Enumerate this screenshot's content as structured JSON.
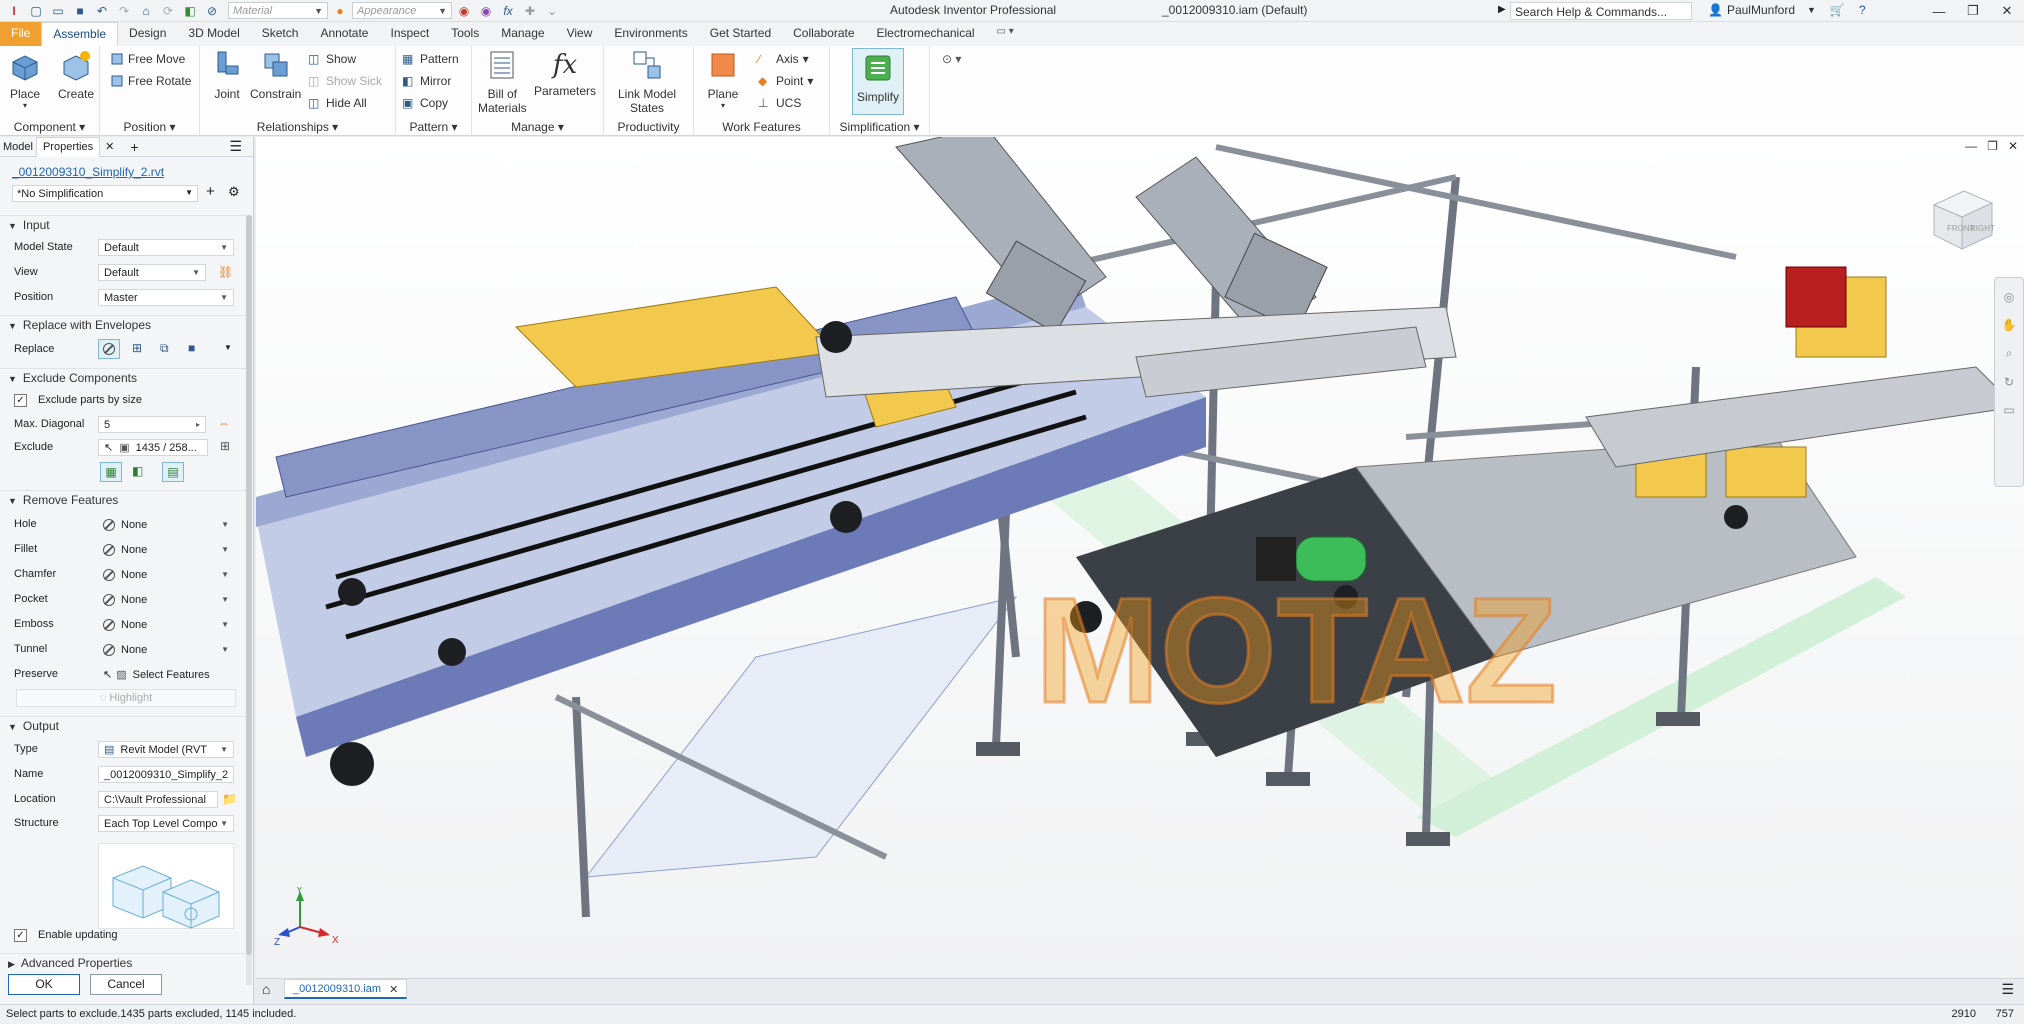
{
  "app": {
    "title": "Autodesk Inventor Professional",
    "document": "_0012009310.iam (Default)",
    "search_placeholder": "Search Help & Commands...",
    "user": "PaulMunford",
    "material_placeholder": "Material",
    "appearance_placeholder": "Appearance"
  },
  "tabs": [
    "File",
    "Assemble",
    "Design",
    "3D Model",
    "Sketch",
    "Annotate",
    "Inspect",
    "Tools",
    "Manage",
    "View",
    "Environments",
    "Get Started",
    "Collaborate",
    "Electromechanical"
  ],
  "active_tab": "Assemble",
  "ribbon": {
    "component": {
      "label": "Component",
      "place": "Place",
      "create": "Create"
    },
    "position": {
      "label": "Position",
      "free_move": "Free Move",
      "free_rotate": "Free Rotate"
    },
    "relationships": {
      "label": "Relationships",
      "joint": "Joint",
      "constrain": "Constrain",
      "show": "Show",
      "show_sick": "Show Sick",
      "hide_all": "Hide All"
    },
    "pattern": {
      "label": "Pattern",
      "pattern": "Pattern",
      "mirror": "Mirror",
      "copy": "Copy"
    },
    "manage": {
      "label": "Manage",
      "bom_line1": "Bill of",
      "bom_line2": "Materials",
      "parameters": "Parameters"
    },
    "productivity": {
      "label": "Productivity",
      "link_line1": "Link Model",
      "link_line2": "States"
    },
    "work_features": {
      "label": "Work Features",
      "plane": "Plane",
      "axis": "Axis",
      "point": "Point",
      "ucs": "UCS"
    },
    "simplification": {
      "label": "Simplification",
      "simplify": "Simplify"
    }
  },
  "panel": {
    "tabs": [
      "Model",
      "Properties"
    ],
    "filename": "_0012009310_Simplify_2.rvt",
    "simplification_select": "*No Simplification",
    "input": {
      "header": "Input",
      "model_state_label": "Model State",
      "model_state": "Default",
      "view_label": "View",
      "view": "Default",
      "position_label": "Position",
      "position": "Master"
    },
    "replace": {
      "header": "Replace with Envelopes",
      "label": "Replace"
    },
    "exclude": {
      "header": "Exclude Components",
      "by_size": "Exclude parts by size",
      "max_diag_label": "Max. Diagonal",
      "max_diag": "5",
      "exclude_label": "Exclude",
      "exclude_value": "1435 / 258..."
    },
    "remove": {
      "header": "Remove Features",
      "rows": [
        {
          "label": "Hole",
          "value": "None"
        },
        {
          "label": "Fillet",
          "value": "None"
        },
        {
          "label": "Chamfer",
          "value": "None"
        },
        {
          "label": "Pocket",
          "value": "None"
        },
        {
          "label": "Emboss",
          "value": "None"
        },
        {
          "label": "Tunnel",
          "value": "None"
        }
      ],
      "preserve_label": "Preserve",
      "preserve_value": "Select Features",
      "highlight": "Highlight"
    },
    "output": {
      "header": "Output",
      "type_label": "Type",
      "type": "Revit Model (RVT",
      "name_label": "Name",
      "name": "_0012009310_Simplify_2",
      "location_label": "Location",
      "location": "C:\\Vault Professional",
      "structure_label": "Structure",
      "structure": "Each Top Level Compo"
    },
    "enable_updating": "Enable updating",
    "advanced": "Advanced Properties",
    "ok": "OK",
    "cancel": "Cancel"
  },
  "viewcube": {
    "front": "FRONT",
    "right": "RIGHT"
  },
  "triad": {
    "x": "X",
    "y": "Y",
    "z": "Z"
  },
  "watermark": "MOTAZ",
  "doc_tab": "_0012009310.iam",
  "status": {
    "message": "Select parts to exclude.1435 parts excluded, 1145 included.",
    "count1": "2910",
    "count2": "757"
  }
}
